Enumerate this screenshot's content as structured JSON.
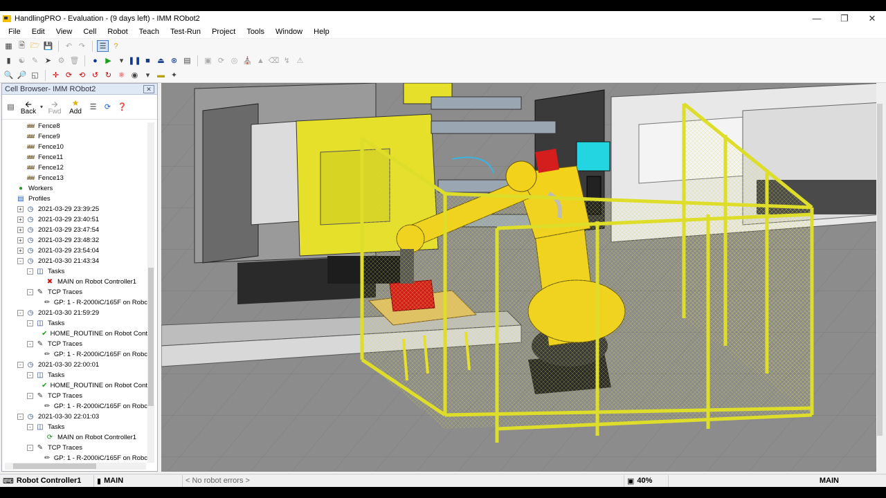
{
  "window": {
    "title": "HandlingPRO - Evaluation - (9 days left) - IMM RObot2"
  },
  "menu": [
    "File",
    "Edit",
    "View",
    "Cell",
    "Robot",
    "Teach",
    "Test-Run",
    "Project",
    "Tools",
    "Window",
    "Help"
  ],
  "panel": {
    "title": "Cell Browser- IMM RObot2",
    "nav": {
      "back": "Back",
      "fwd": "Fwd",
      "add": "Add"
    },
    "tree": [
      {
        "label": "Fence8",
        "level": 1,
        "icon": "fence-icon"
      },
      {
        "label": "Fence9",
        "level": 1,
        "icon": "fence-icon"
      },
      {
        "label": "Fence10",
        "level": 1,
        "icon": "fence-icon"
      },
      {
        "label": "Fence11",
        "level": 1,
        "icon": "fence-icon"
      },
      {
        "label": "Fence12",
        "level": 1,
        "icon": "fence-icon"
      },
      {
        "label": "Fence13",
        "level": 1,
        "icon": "fence-icon"
      },
      {
        "label": "Workers",
        "level": 0,
        "icon": "workers-icon"
      },
      {
        "label": "Profiles",
        "level": 0,
        "icon": "profiles-icon"
      },
      {
        "label": "2021-03-29 23:39:25",
        "level": 1,
        "icon": "profile-icon",
        "exp": "+"
      },
      {
        "label": "2021-03-29 23:40:51",
        "level": 1,
        "icon": "profile-icon",
        "exp": "+"
      },
      {
        "label": "2021-03-29 23:47:54",
        "level": 1,
        "icon": "profile-icon",
        "exp": "+"
      },
      {
        "label": "2021-03-29 23:48:32",
        "level": 1,
        "icon": "profile-icon",
        "exp": "+"
      },
      {
        "label": "2021-03-29 23:54:04",
        "level": 1,
        "icon": "profile-icon",
        "exp": "+"
      },
      {
        "label": "2021-03-30 21:43:34",
        "level": 1,
        "icon": "profile-icon",
        "exp": "-"
      },
      {
        "label": "Tasks",
        "level": 2,
        "icon": "tasks-icon",
        "exp": "-"
      },
      {
        "label": "MAIN on Robot Controller1",
        "level": 3,
        "icon": "error-icon"
      },
      {
        "label": "TCP Traces",
        "level": 2,
        "icon": "trace-icon",
        "exp": "-"
      },
      {
        "label": "GP: 1 - R-2000iC/165F on Robc",
        "level": 3,
        "icon": "pen-icon"
      },
      {
        "label": "2021-03-30 21:59:29",
        "level": 1,
        "icon": "profile-icon",
        "exp": "-"
      },
      {
        "label": "Tasks",
        "level": 2,
        "icon": "tasks-icon",
        "exp": "-"
      },
      {
        "label": "HOME_ROUTINE on Robot Cont",
        "level": 3,
        "icon": "check-icon"
      },
      {
        "label": "TCP Traces",
        "level": 2,
        "icon": "trace-icon",
        "exp": "-"
      },
      {
        "label": "GP: 1 - R-2000iC/165F on Robc",
        "level": 3,
        "icon": "pen-icon"
      },
      {
        "label": "2021-03-30 22:00:01",
        "level": 1,
        "icon": "profile-icon",
        "exp": "-"
      },
      {
        "label": "Tasks",
        "level": 2,
        "icon": "tasks-icon",
        "exp": "-"
      },
      {
        "label": "HOME_ROUTINE on Robot Cont",
        "level": 3,
        "icon": "check-icon"
      },
      {
        "label": "TCP Traces",
        "level": 2,
        "icon": "trace-icon",
        "exp": "-"
      },
      {
        "label": "GP: 1 - R-2000iC/165F on Robc",
        "level": 3,
        "icon": "pen-icon"
      },
      {
        "label": "2021-03-30 22:01:03",
        "level": 1,
        "icon": "profile-icon",
        "exp": "-"
      },
      {
        "label": "Tasks",
        "level": 2,
        "icon": "tasks-icon",
        "exp": "-"
      },
      {
        "label": "MAIN on Robot Controller1",
        "level": 3,
        "icon": "running-icon"
      },
      {
        "label": "TCP Traces",
        "level": 2,
        "icon": "trace-icon",
        "exp": "-"
      },
      {
        "label": "GP: 1 - R-2000iC/165F on Robc",
        "level": 3,
        "icon": "pen-icon"
      }
    ]
  },
  "status": {
    "controller": "Robot Controller1",
    "program": "MAIN",
    "errors": "< No robot errors >",
    "zoom": "40%",
    "right_program": "MAIN"
  },
  "colors": {
    "machine_yellow": "#e6e02a",
    "robot_yellow": "#f2d21b",
    "floor": "#8d8d8d",
    "fence": "#dede2a"
  }
}
